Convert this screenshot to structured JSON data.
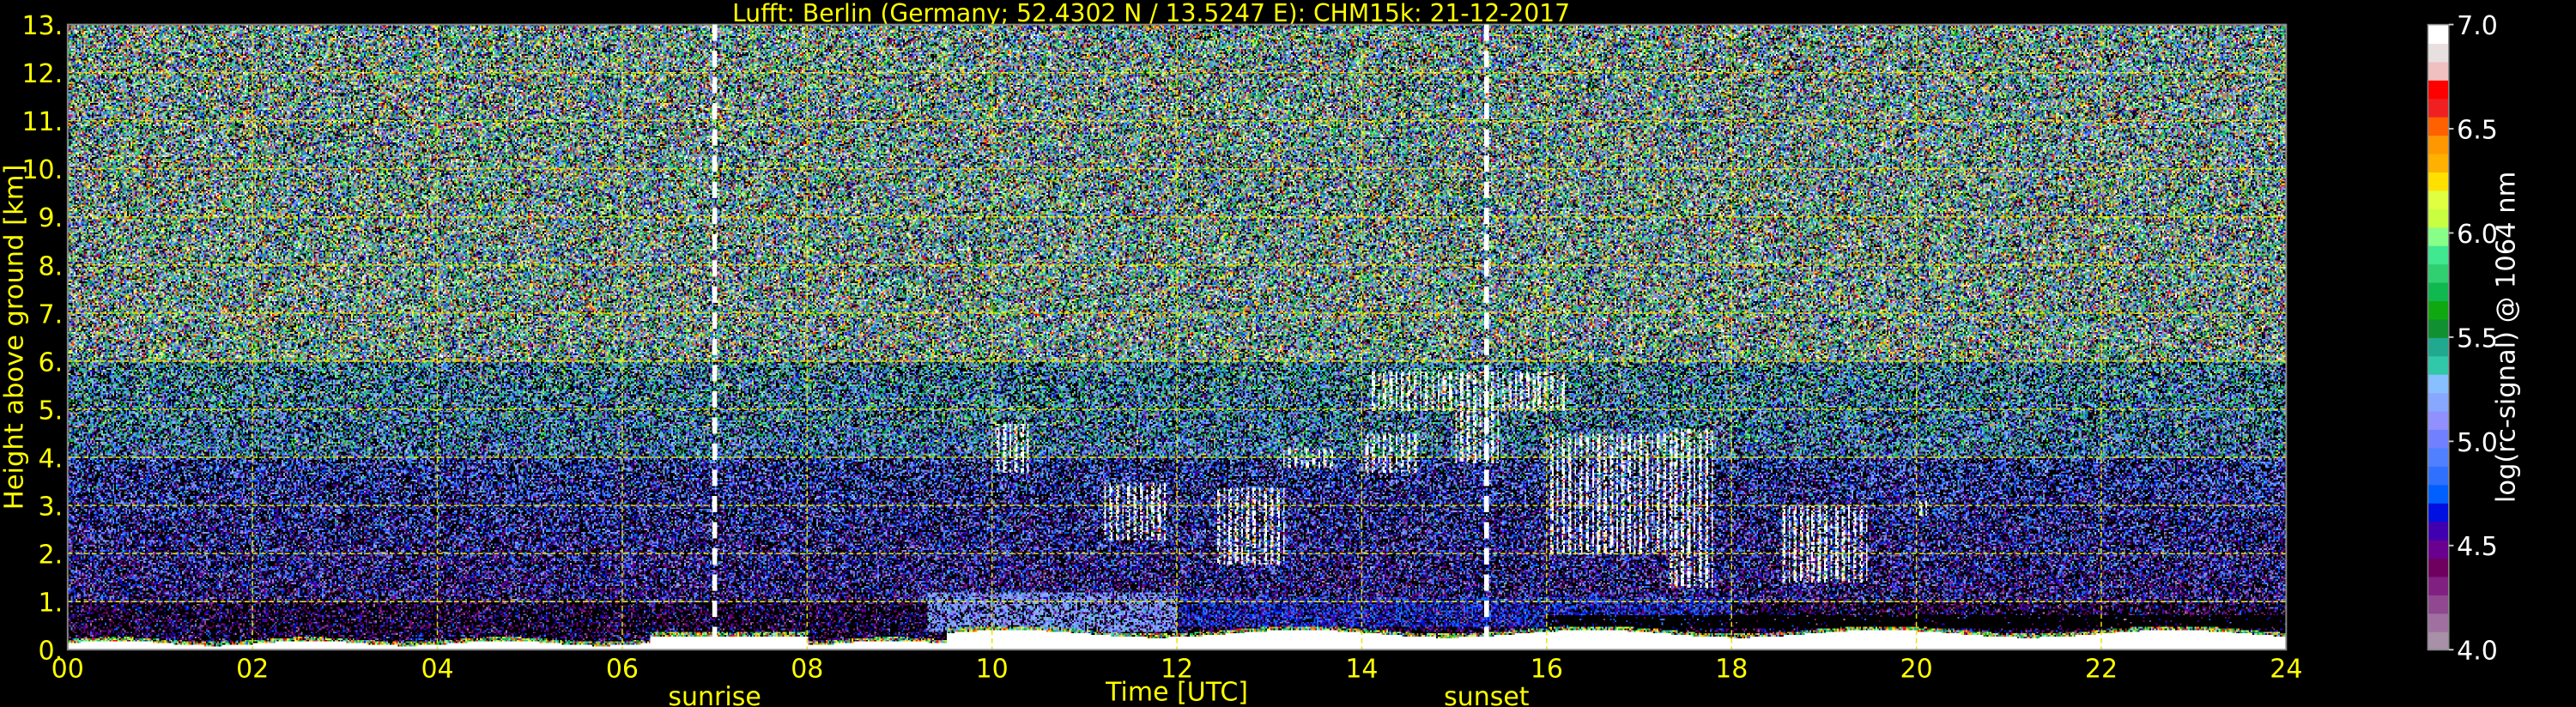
{
  "chart_data": {
    "type": "heatmap",
    "title": "Lufft: Berlin (Germany; 52.4302 N / 13.5247 E):    CHM15k: 21-12-2017",
    "xlabel": "Time [UTC]",
    "ylabel": "Height above ground [km]",
    "xlim": [
      0,
      24
    ],
    "ylim": [
      0,
      13
    ],
    "x_ticks": [
      0,
      2,
      4,
      6,
      8,
      10,
      12,
      14,
      16,
      18,
      20,
      22,
      24
    ],
    "x_tick_labels": [
      "00",
      "02",
      "04",
      "06",
      "08",
      "10",
      "12",
      "14",
      "16",
      "18",
      "20",
      "22",
      "24"
    ],
    "y_ticks": [
      0,
      1,
      2,
      3,
      4,
      5,
      6,
      7,
      8,
      9,
      10,
      11,
      12,
      13
    ],
    "y_tick_labels": [
      "0.",
      "1.",
      "2.",
      "3.",
      "4.",
      "5.",
      "6.",
      "7.",
      "8.",
      "9.",
      "10.",
      "11.",
      "12.",
      "13."
    ],
    "grid": true,
    "vlines": [
      {
        "x": 7.0,
        "label": "sunrise"
      },
      {
        "x": 15.35,
        "label": "sunset"
      }
    ],
    "colorbar": {
      "label": "log(rc-signal) @ 1064 nm",
      "range": [
        4.0,
        7.0
      ],
      "ticks": [
        4.0,
        4.5,
        5.0,
        5.5,
        6.0,
        6.5,
        7.0
      ],
      "tick_labels": [
        "4.0",
        "4.5",
        "5.0",
        "5.5",
        "6.0",
        "6.5",
        "7.0"
      ],
      "colors": [
        "#a890a8",
        "#a070a0",
        "#904890",
        "#802080",
        "#700060",
        "#6a0090",
        "#4000b0",
        "#0010e0",
        "#0060ff",
        "#3070ff",
        "#5080ff",
        "#7080ff",
        "#9090ff",
        "#88a8ff",
        "#88c0ff",
        "#30c8a8",
        "#20a890",
        "#109030",
        "#10a810",
        "#10b850",
        "#30d070",
        "#40e890",
        "#88ff88",
        "#c8ff40",
        "#e0ff40",
        "#ffe000",
        "#ffb000",
        "#ff9800",
        "#ff6000",
        "#f02020",
        "#ff0000",
        "#f0c0c0",
        "#e8e0e0",
        "#ffffff"
      ]
    },
    "features": [
      {
        "kind": "cloud",
        "t": [
          10.0,
          10.4
        ],
        "h": [
          3.7,
          4.7
        ]
      },
      {
        "kind": "cloud",
        "t": [
          11.2,
          11.9
        ],
        "h": [
          2.3,
          3.5
        ]
      },
      {
        "kind": "cloud",
        "t": [
          12.4,
          13.2
        ],
        "h": [
          1.8,
          3.4
        ]
      },
      {
        "kind": "cloud",
        "t": [
          13.1,
          13.7
        ],
        "h": [
          3.8,
          4.2
        ]
      },
      {
        "kind": "cloud",
        "t": [
          14.0,
          14.6
        ],
        "h": [
          3.7,
          4.5
        ]
      },
      {
        "kind": "cloud",
        "t": [
          14.1,
          16.2
        ],
        "h": [
          5.0,
          5.8
        ]
      },
      {
        "kind": "cloud",
        "t": [
          15.0,
          15.5
        ],
        "h": [
          3.9,
          5.0
        ]
      },
      {
        "kind": "cloud",
        "t": [
          16.0,
          17.3
        ],
        "h": [
          2.0,
          4.5
        ]
      },
      {
        "kind": "cloud",
        "t": [
          17.3,
          17.8
        ],
        "h": [
          1.3,
          4.6
        ]
      },
      {
        "kind": "cloud",
        "t": [
          18.5,
          19.5
        ],
        "h": [
          1.4,
          3.0
        ]
      },
      {
        "kind": "cloud",
        "t": [
          20.0,
          20.1
        ],
        "h": [
          2.8,
          3.1
        ]
      }
    ]
  }
}
